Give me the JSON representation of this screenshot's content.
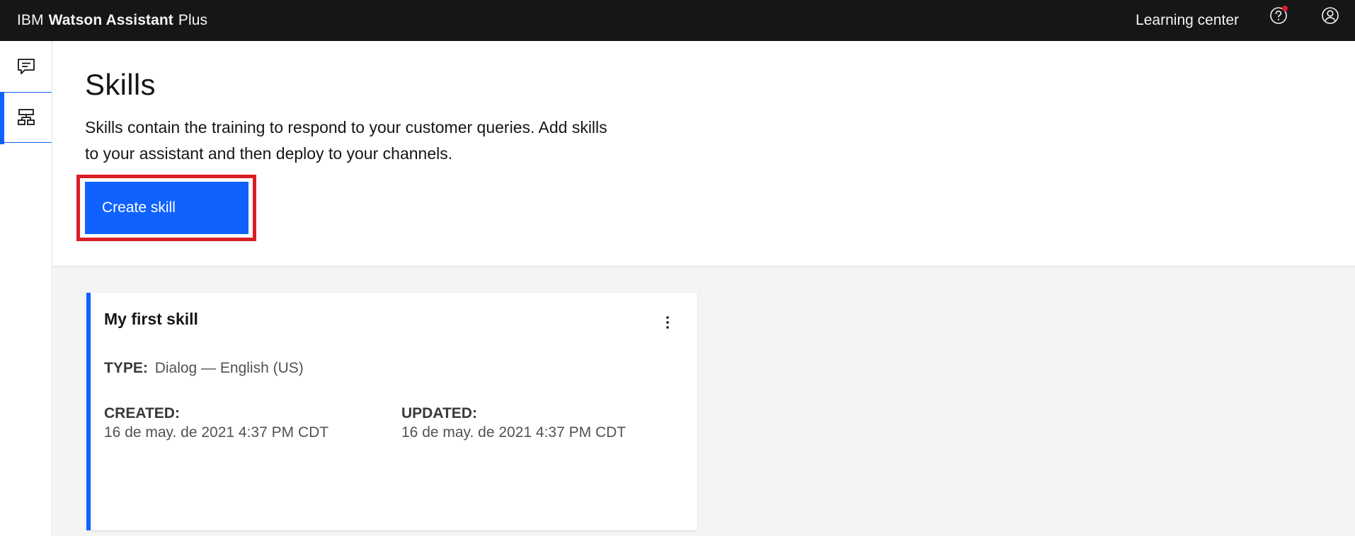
{
  "header": {
    "brand_prefix": "IBM",
    "brand_main": "Watson Assistant",
    "brand_suffix": "Plus",
    "learning_center_label": "Learning center",
    "background_color": "#161616",
    "notification_color": "#da1e28"
  },
  "siderail": {
    "items": [
      {
        "icon": "chat-icon",
        "active": false
      },
      {
        "icon": "skills-icon",
        "active": true
      }
    ],
    "accent_color": "#0f62fe"
  },
  "page": {
    "title": "Skills",
    "description": "Skills contain the training to respond to your customer queries. Add skills to your assistant and then deploy to your channels.",
    "create_button_label": "Create skill",
    "button_color": "#0f62fe",
    "highlight_color": "#da1e28"
  },
  "skills": [
    {
      "name": "My first skill",
      "type_label": "TYPE:",
      "type_value": "Dialog — English (US)",
      "created_label": "CREATED:",
      "created_value": "16 de may. de 2021 4:37 PM CDT",
      "updated_label": "UPDATED:",
      "updated_value": "16 de may. de 2021 4:37 PM CDT"
    }
  ]
}
